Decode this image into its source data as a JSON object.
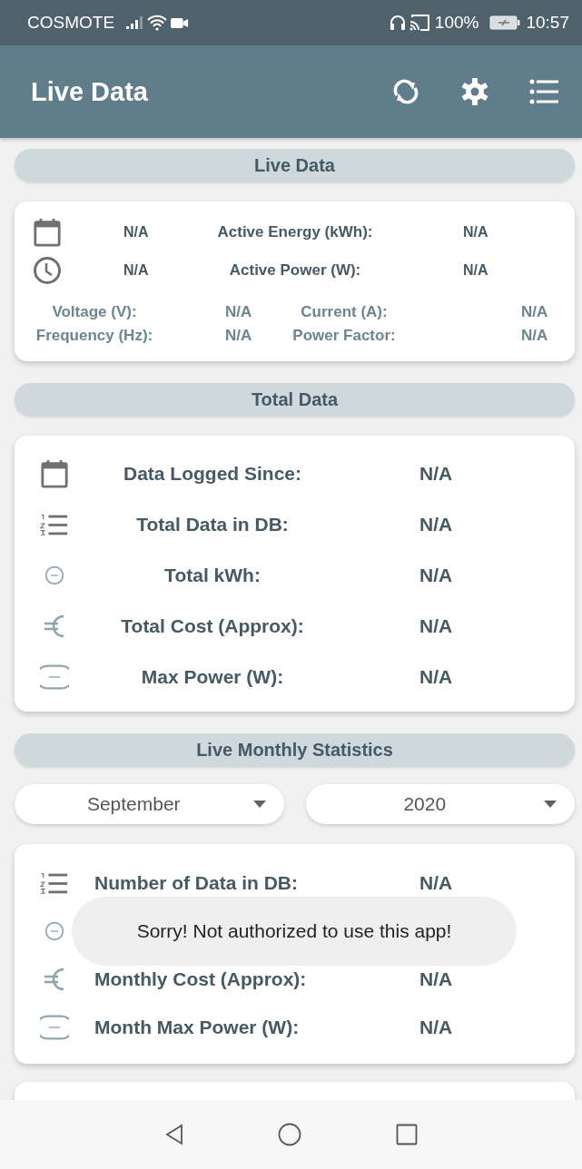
{
  "status_bar": {
    "carrier": "COSMOTE",
    "battery": "100%",
    "time": "10:57"
  },
  "app_bar": {
    "title": "Live Data"
  },
  "live_data": {
    "header": "Live Data",
    "rows": [
      {
        "kind": "calendar",
        "value": "N/A",
        "label": "Active Energy (kWh):",
        "reading": "N/A"
      },
      {
        "kind": "clock",
        "value": "N/A",
        "label": "Active Power (W):",
        "reading": "N/A"
      }
    ],
    "measurements": [
      {
        "label": "Voltage (V):",
        "value": "N/A"
      },
      {
        "label": "Current (A):",
        "value": "N/A"
      },
      {
        "label": "Frequency (Hz):",
        "value": "N/A"
      },
      {
        "label": "Power Factor:",
        "value": "N/A"
      }
    ]
  },
  "total_data": {
    "header": "Total Data",
    "rows": [
      {
        "kind": "calendar",
        "label": "Data Logged Since:",
        "value": "N/A"
      },
      {
        "kind": "list",
        "label": "Total Data in DB:",
        "value": "N/A"
      },
      {
        "kind": "kwh",
        "label": "Total kWh:",
        "value": "N/A"
      },
      {
        "kind": "euro",
        "label": "Total Cost (Approx):",
        "value": "N/A"
      },
      {
        "kind": "pmax",
        "label": "Max Power (W):",
        "value": "N/A"
      }
    ]
  },
  "monthly": {
    "header": "Live Monthly Statistics",
    "month": "September",
    "year": "2020",
    "rows": [
      {
        "kind": "list",
        "label": "Number of Data in DB:",
        "value": "N/A"
      },
      {
        "kind": "kwh"
      },
      {
        "kind": "euro",
        "label": "Monthly Cost (Approx):",
        "value": "N/A"
      },
      {
        "kind": "pmax",
        "label": "Month Max Power (W):",
        "value": "N/A"
      }
    ]
  },
  "toast": "Sorry! Not authorized to use this app!"
}
